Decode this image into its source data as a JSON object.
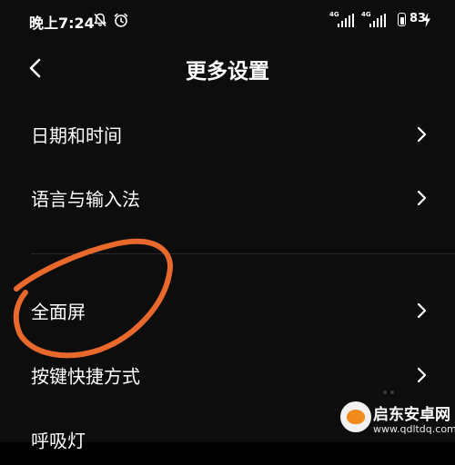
{
  "status_bar": {
    "time": "晚上7:24",
    "network_1": "4G",
    "network_2": "4G",
    "battery": "83"
  },
  "header": {
    "title": "更多设置"
  },
  "menu": {
    "items": [
      {
        "label": "日期和时间"
      },
      {
        "label": "语言与输入法"
      },
      {
        "label": "全面屏"
      },
      {
        "label": "按键快捷方式"
      },
      {
        "label": "呼吸灯"
      }
    ]
  },
  "watermark": {
    "title": "启东安卓网",
    "url": "www.qdltdq.com"
  },
  "colors": {
    "background": "#0d0d0d",
    "text": "#ffffff",
    "annotation": "#e8692b",
    "chevron": "#ffffff"
  }
}
